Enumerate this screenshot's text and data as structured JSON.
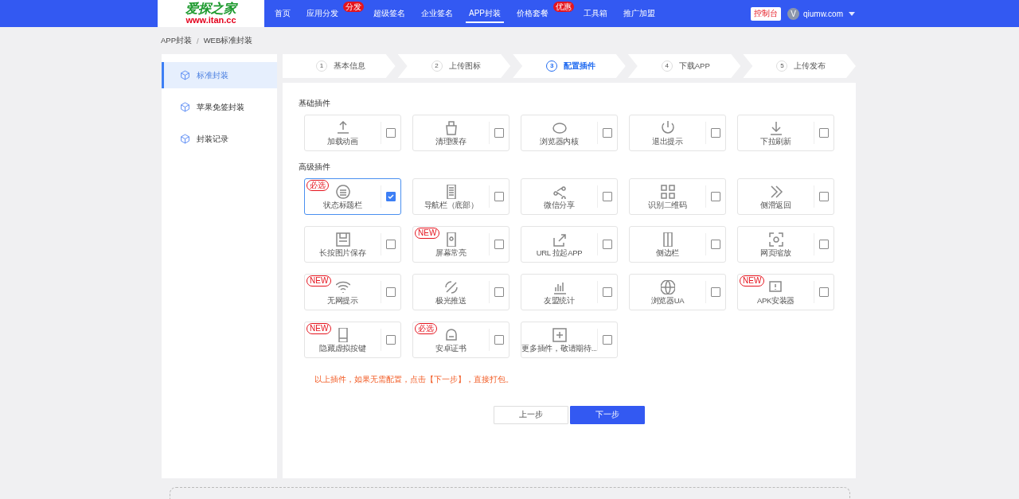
{
  "logo": {
    "title": "爱探之家",
    "url": "www.itan.cc"
  },
  "nav": [
    {
      "label": "首页",
      "selected": false
    },
    {
      "label": "应用分发",
      "selected": false,
      "badge": "分发"
    },
    {
      "label": "超级签名",
      "selected": false
    },
    {
      "label": "企业签名",
      "selected": false
    },
    {
      "label": "APP封装",
      "selected": true
    },
    {
      "label": "价格套餐",
      "selected": false,
      "badge": "优惠"
    },
    {
      "label": "工具箱",
      "selected": false
    },
    {
      "label": "推广加盟",
      "selected": false
    }
  ],
  "console_button": "控制台",
  "user": {
    "avatar_letter": "V",
    "name": "qiumw.com"
  },
  "breadcrumb": {
    "items": [
      "APP封装",
      "WEB标准封装"
    ],
    "separator": "/"
  },
  "sidebar": {
    "items": [
      {
        "label": "标准封装",
        "selected": true
      },
      {
        "label": "苹果免签封装",
        "selected": false
      },
      {
        "label": "封装记录",
        "selected": false
      }
    ]
  },
  "steps": [
    {
      "number": "1",
      "label": "基本信息",
      "selected": false
    },
    {
      "number": "2",
      "label": "上传图标",
      "selected": false
    },
    {
      "number": "3",
      "label": "配置插件",
      "selected": true
    },
    {
      "number": "4",
      "label": "下载APP",
      "selected": false
    },
    {
      "number": "5",
      "label": "上传发布",
      "selected": false
    }
  ],
  "sections": [
    {
      "title": "基础插件",
      "plugins": [
        {
          "label": "加载动画",
          "checked": false
        },
        {
          "label": "清理缓存",
          "checked": false
        },
        {
          "label": "浏览器内核",
          "checked": false
        },
        {
          "label": "退出提示",
          "checked": false
        },
        {
          "label": "下拉刷新",
          "checked": false
        }
      ]
    },
    {
      "title": "高级插件",
      "plugins": [
        {
          "label": "状态标题栏",
          "checked": true,
          "badge": "必选"
        },
        {
          "label": "导航栏（底部）",
          "checked": false
        },
        {
          "label": "微信分享",
          "checked": false
        },
        {
          "label": "识别二维码",
          "checked": false
        },
        {
          "label": "侧滑返回",
          "checked": false
        },
        {
          "label": "长按图片保存",
          "checked": false
        },
        {
          "label": "屏幕常亮",
          "checked": false,
          "badge": "NEW"
        },
        {
          "label": "URL 拉起APP",
          "checked": false
        },
        {
          "label": "侧边栏",
          "checked": false
        },
        {
          "label": "网页缩放",
          "checked": false
        },
        {
          "label": "无网提示",
          "checked": false,
          "badge": "NEW"
        },
        {
          "label": "极光推送",
          "checked": false
        },
        {
          "label": "友盟统计",
          "checked": false
        },
        {
          "label": "浏览器UA",
          "checked": false
        },
        {
          "label": "APK安装器",
          "checked": false,
          "badge": "NEW"
        },
        {
          "label": "隐藏虚拟按键",
          "checked": false,
          "badge": "NEW"
        },
        {
          "label": "安卓证书",
          "checked": false,
          "badge": "必选"
        },
        {
          "label": "更多插件，敬请期待...",
          "checked": false
        }
      ]
    }
  ],
  "notice": "以上插件，如果无需配置，点击【下一步】，直接打包。",
  "buttons": {
    "prev": "上一步",
    "next": "下一步"
  }
}
